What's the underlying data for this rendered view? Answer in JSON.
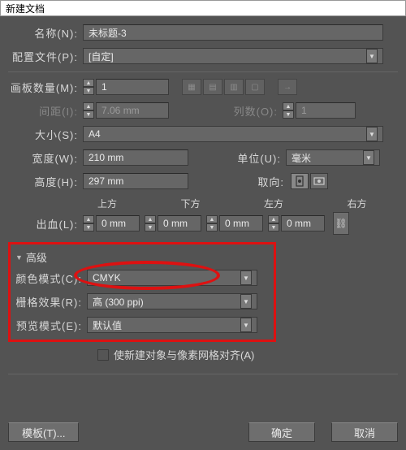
{
  "window": {
    "title": "新建文档"
  },
  "name": {
    "label": "名称(N):",
    "value": "未标题-3"
  },
  "profile": {
    "label": "配置文件(P):",
    "value": "[自定]"
  },
  "artboards": {
    "label": "画板数量(M):",
    "value": "1"
  },
  "spacing": {
    "label": "间距(I):",
    "value": "7.06 mm"
  },
  "cols": {
    "label": "列数(O):",
    "value": "1"
  },
  "size": {
    "label": "大小(S):",
    "value": "A4"
  },
  "width": {
    "label": "宽度(W):",
    "value": "210 mm"
  },
  "height": {
    "label": "高度(H):",
    "value": "297 mm"
  },
  "unit": {
    "label": "单位(U):",
    "value": "毫米"
  },
  "orient": {
    "label": "取向:"
  },
  "bleed": {
    "label": "出血(L):",
    "heads": {
      "top": "上方",
      "bottom": "下方",
      "left": "左方",
      "right": "右方"
    },
    "top": "0 mm",
    "bottom": "0 mm",
    "left": "0 mm",
    "right": "0 mm"
  },
  "advanced": {
    "title": "高级",
    "color": {
      "label": "颜色模式(C):",
      "value": "CMYK"
    },
    "raster": {
      "label": "栅格效果(R):",
      "value": "高 (300 ppi)"
    },
    "preview": {
      "label": "预览模式(E):",
      "value": "默认值"
    }
  },
  "align": {
    "label": "使新建对象与像素网格对齐(A)"
  },
  "buttons": {
    "template": "模板(T)...",
    "ok": "确定",
    "cancel": "取消"
  }
}
